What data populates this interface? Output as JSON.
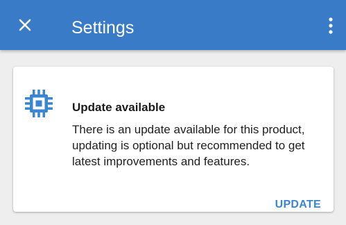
{
  "app_bar": {
    "title": "Settings",
    "close_icon": "close-icon",
    "more_icon": "more-vert-icon",
    "color": "#3a7bc8"
  },
  "update_card": {
    "icon": "chip-icon",
    "icon_color": "#3a86d0",
    "title": "Update available",
    "body": "There is an update available for this product, updating is optional but recommended to get latest improvements and features.",
    "action_label": "UPDATE"
  }
}
